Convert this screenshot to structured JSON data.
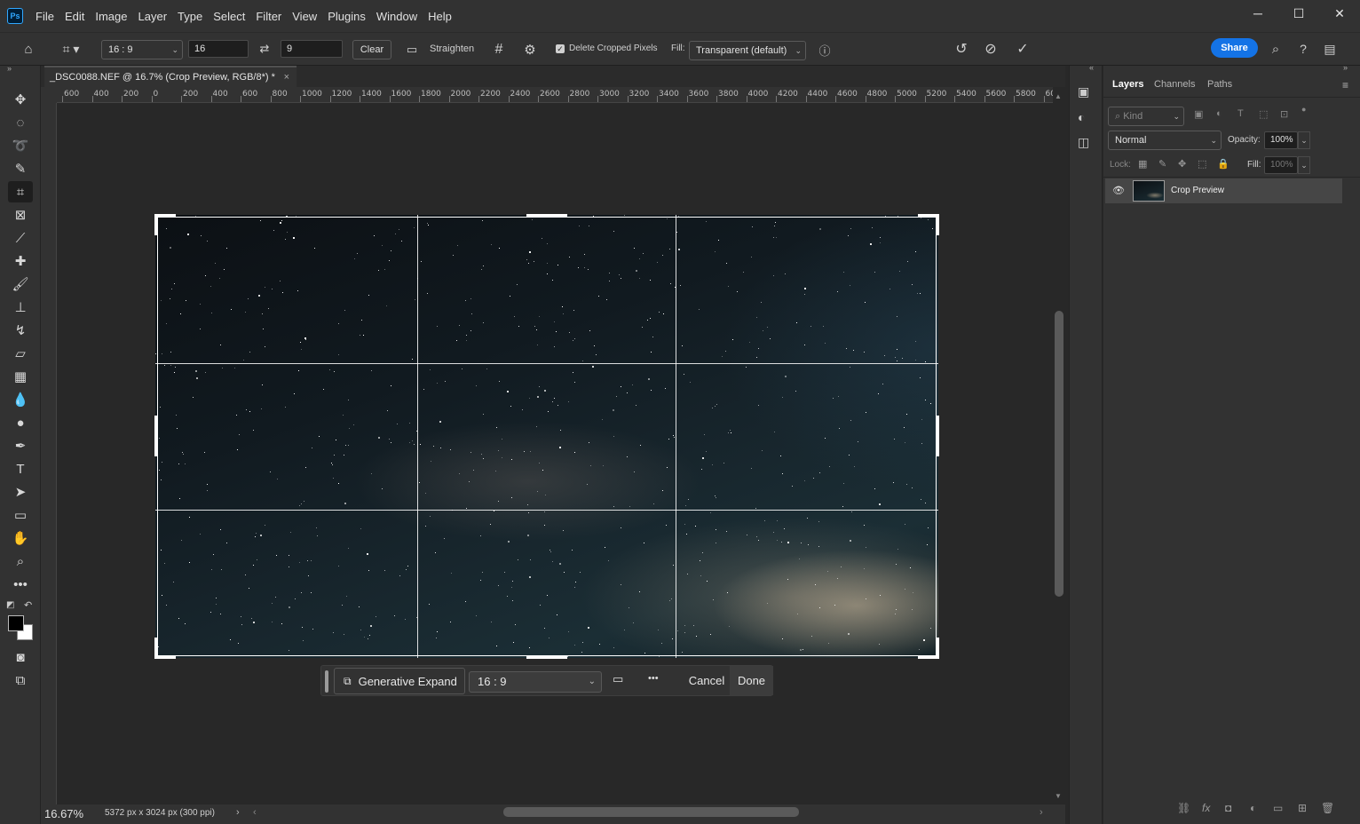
{
  "app": {
    "logo": "Ps"
  },
  "menu": [
    "File",
    "Edit",
    "Image",
    "Layer",
    "Type",
    "Select",
    "Filter",
    "View",
    "Plugins",
    "Window",
    "Help"
  ],
  "window_controls": {
    "minimize": "─",
    "maximize": "☐",
    "close": "✕"
  },
  "options_bar": {
    "ratio_preset": "16 : 9",
    "width_value": "16",
    "height_value": "9",
    "clear_label": "Clear",
    "straighten_label": "Straighten",
    "delete_cropped_label": "Delete Cropped Pixels",
    "delete_cropped_checked": true,
    "fill_label": "Fill:",
    "fill_value": "Transparent (default)",
    "share_label": "Share"
  },
  "document": {
    "tab_title": "_DSC0088.NEF @ 16.7% (Crop Preview, RGB/8*) *",
    "tab_close": "×"
  },
  "ruler": {
    "h_labels": [
      "600",
      "400",
      "200",
      "0",
      "200",
      "400",
      "600",
      "800",
      "1000",
      "1200",
      "1400",
      "1600",
      "1800",
      "2000",
      "2200",
      "2400",
      "2600",
      "2800",
      "3000",
      "3200",
      "3400",
      "3600",
      "3800",
      "4000",
      "4200",
      "4400",
      "4600",
      "4800",
      "5000",
      "5200",
      "5400",
      "5600",
      "5800",
      "60"
    ]
  },
  "context_bar": {
    "generative_expand_label": "Generative Expand",
    "ratio_value": "16 : 9",
    "more_label": "•••",
    "cancel_label": "Cancel",
    "done_label": "Done"
  },
  "status": {
    "zoom": "16.67%",
    "doc_info": "5372 px x 3024 px (300 ppi)"
  },
  "panel": {
    "tabs": [
      "Layers",
      "Channels",
      "Paths"
    ],
    "active_tab": "Layers",
    "kind_placeholder": "Kind",
    "blend_mode": "Normal",
    "opacity_label": "Opacity:",
    "opacity_value": "100%",
    "lock_label": "Lock:",
    "fill_label": "Fill:",
    "fill_value": "100%",
    "layers": [
      {
        "name": "Crop Preview",
        "visible": true
      }
    ]
  },
  "colors": {
    "accent": "#1473e6",
    "panel_bg": "#323232",
    "canvas_bg": "#282828"
  }
}
